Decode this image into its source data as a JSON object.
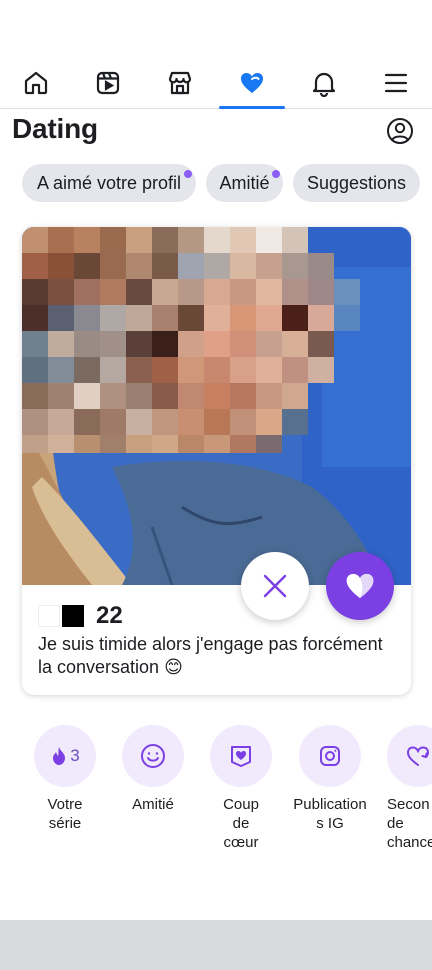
{
  "nav": {
    "items": [
      {
        "icon": "home-icon"
      },
      {
        "icon": "video-icon"
      },
      {
        "icon": "marketplace-icon"
      },
      {
        "icon": "dating-heart-icon",
        "active": true
      },
      {
        "icon": "bell-icon"
      },
      {
        "icon": "menu-icon"
      }
    ],
    "accent": "#1877f2"
  },
  "header": {
    "title": "Dating",
    "profile_icon": "profile-icon"
  },
  "chips": [
    {
      "label": "A aimé votre profil",
      "dot": true
    },
    {
      "label": "Amitié",
      "dot": true
    },
    {
      "label": "Suggestions",
      "dot": false
    }
  ],
  "card": {
    "age": "22",
    "bio": "Je suis timide alors j'engage pas forcément la conversation 😊",
    "pass_icon": "close-icon",
    "like_icon": "heart-icon",
    "like_color": "#7b3fe4"
  },
  "shortcuts": [
    {
      "label": "Votre série",
      "icon": "flame-icon",
      "count": "3"
    },
    {
      "label": "Amitié",
      "icon": "smiley-icon"
    },
    {
      "label": "Coup de cœur",
      "icon": "heart-badge-icon"
    },
    {
      "label": "Publications IG",
      "icon": "instagram-icon"
    },
    {
      "label": "Seconde chance",
      "icon": "second-chance-icon"
    }
  ]
}
